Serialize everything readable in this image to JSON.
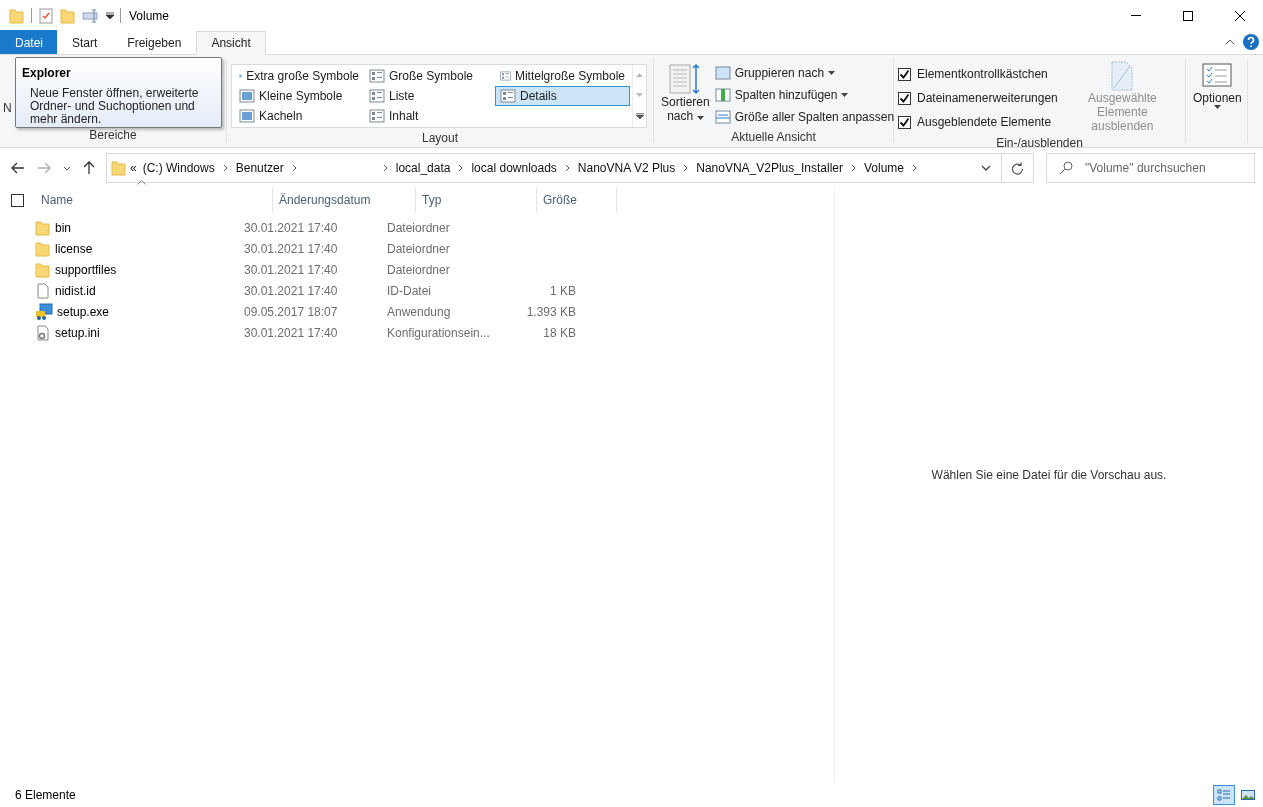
{
  "window": {
    "title": "Volume"
  },
  "ribbon_tabs": [
    {
      "label": "Datei",
      "kind": "file",
      "selected": false
    },
    {
      "label": "Start",
      "kind": "tab",
      "selected": false
    },
    {
      "label": "Freigeben",
      "kind": "tab",
      "selected": false
    },
    {
      "label": "Ansicht",
      "kind": "tab",
      "selected": true
    }
  ],
  "tooltip": {
    "title": "Explorer",
    "text": "Neue Fenster öffnen, erweiterte Ordner- und Suchoptionen und mehr ändern."
  },
  "panes_group": {
    "label": "Bereiche",
    "covered_text": "N"
  },
  "layout_group": {
    "label": "Layout",
    "options": [
      {
        "label": "Extra große Symbole",
        "selected": false
      },
      {
        "label": "Große Symbole",
        "selected": false
      },
      {
        "label": "Mittelgroße Symbole",
        "selected": false
      },
      {
        "label": "Kleine Symbole",
        "selected": false
      },
      {
        "label": "Liste",
        "selected": false
      },
      {
        "label": "Details",
        "selected": true
      },
      {
        "label": "Kacheln",
        "selected": false
      },
      {
        "label": "Inhalt",
        "selected": false
      }
    ]
  },
  "current_view_group": {
    "label": "Aktuelle Ansicht",
    "sort_lines": [
      "Sortieren",
      "nach"
    ],
    "commands": [
      {
        "label": "Gruppieren nach",
        "dropdown": true
      },
      {
        "label": "Spalten hinzufügen",
        "dropdown": true
      },
      {
        "label": "Größe aller Spalten anpassen",
        "dropdown": false
      }
    ]
  },
  "show_hide_group": {
    "label": "Ein-/ausblenden",
    "checkboxes": [
      {
        "label": "Elementkontrollkästchen",
        "checked": true
      },
      {
        "label": "Dateinamenerweiterungen",
        "checked": true
      },
      {
        "label": "Ausgeblendete Elemente",
        "checked": true
      }
    ],
    "hide_selected": {
      "lines": [
        "Ausgewählte",
        "Elemente ausblenden"
      ],
      "disabled": true
    }
  },
  "options_button": {
    "label": "Optionen"
  },
  "breadcrumbs": [
    {
      "kind": "overflow",
      "label": "«"
    },
    {
      "kind": "crumb",
      "label": "(C:) Windows"
    },
    {
      "kind": "crumb",
      "label": "Benutzer"
    },
    {
      "kind": "blank"
    },
    {
      "kind": "crumb",
      "label": "local_data"
    },
    {
      "kind": "crumb",
      "label": "local downloads"
    },
    {
      "kind": "crumb",
      "label": "NanoVNA V2 Plus"
    },
    {
      "kind": "crumb",
      "label": "NanoVNA_V2Plus_Installer"
    },
    {
      "kind": "crumb",
      "label": "Volume"
    }
  ],
  "search": {
    "placeholder": "\"Volume\" durchsuchen"
  },
  "select_all": {
    "checked": false
  },
  "columns": [
    {
      "label": "Name",
      "sorted": true
    },
    {
      "label": "Änderungsdatum",
      "sorted": false
    },
    {
      "label": "Typ",
      "sorted": false
    },
    {
      "label": "Größe",
      "sorted": false
    }
  ],
  "files": [
    {
      "name": "bin",
      "date": "30.01.2021 17:40",
      "type": "Dateiordner",
      "kind": "folder"
    },
    {
      "name": "license",
      "date": "30.01.2021 17:40",
      "type": "Dateiordner",
      "kind": "folder"
    },
    {
      "name": "supportfiles",
      "date": "30.01.2021 17:40",
      "type": "Dateiordner",
      "kind": "folder"
    },
    {
      "name": "nidist.id",
      "date": "30.01.2021 17:40",
      "type": "ID-Datei",
      "size": "1 KB",
      "kind": "file"
    },
    {
      "name": "setup.exe",
      "date": "09.05.2017 18:07",
      "type": "Anwendung",
      "size": "1.393 KB",
      "kind": "exe"
    },
    {
      "name": "setup.ini",
      "date": "30.01.2021 17:40",
      "type": "Konfigurationsein...",
      "size": "18 KB",
      "kind": "ini"
    }
  ],
  "preview": {
    "message": "Wählen Sie eine Datei für die Vorschau aus."
  },
  "status_bar": {
    "count": "6 Elemente",
    "views": [
      {
        "kind": "details",
        "selected": true
      },
      {
        "kind": "large",
        "selected": false
      }
    ]
  }
}
